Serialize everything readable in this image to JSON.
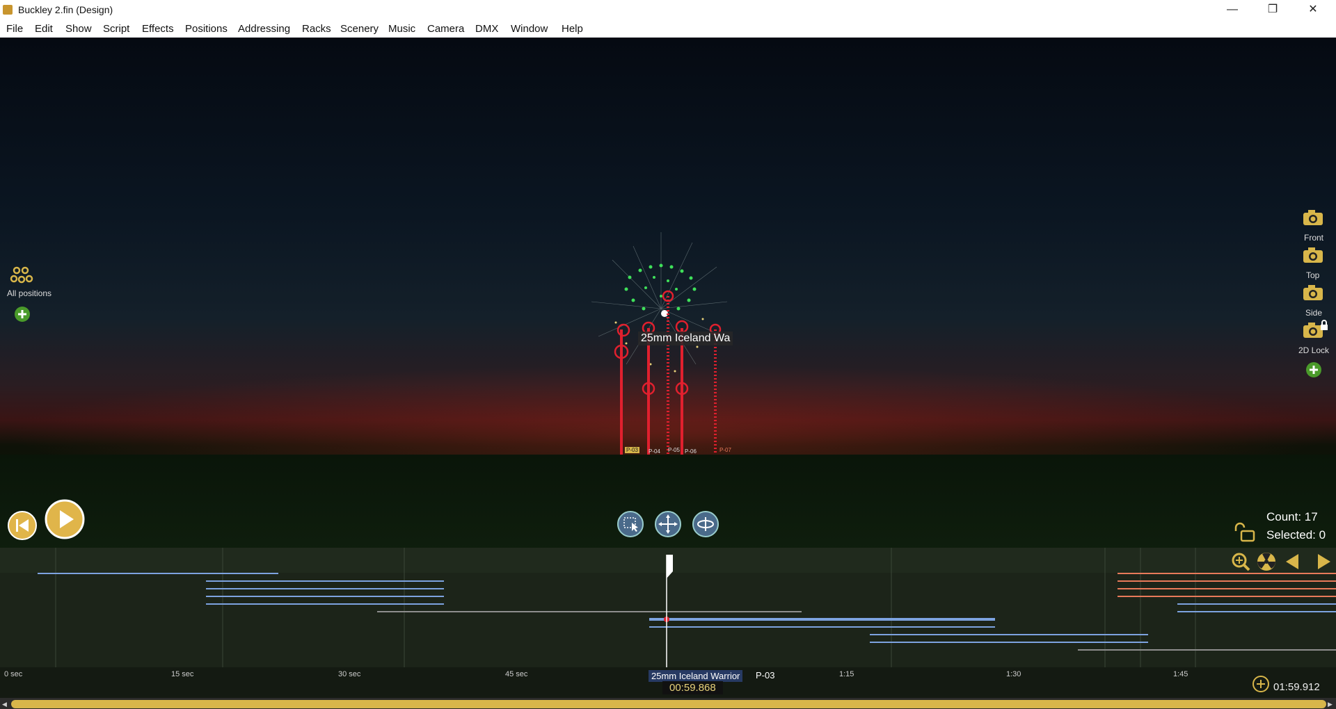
{
  "window": {
    "title": "Buckley 2.fin (Design)",
    "minimize": "—",
    "restore": "❐",
    "close": "✕"
  },
  "menu": [
    "File",
    "Edit",
    "Show",
    "Script",
    "Effects",
    "Positions",
    "Addressing",
    "Racks",
    "Scenery",
    "Music",
    "Camera",
    "DMX",
    "Window",
    "Help"
  ],
  "viewport": {
    "tooltip": "25mm Iceland Wa",
    "all_positions_label": "All positions",
    "cameras": [
      "Front",
      "Top",
      "Side",
      "2D Lock"
    ],
    "position_tags": [
      "P-03",
      "P-04",
      "P-05",
      "P-06",
      "P-07"
    ],
    "count_label": "Count: 17",
    "selected_label": "Selected: 0"
  },
  "timeline": {
    "ticks": [
      "0 sec",
      "15 sec",
      "30 sec",
      "45 sec",
      "1:15",
      "1:30",
      "1:45"
    ],
    "cue_name": "25mm Iceland Warrior",
    "cue_position": "P-03",
    "current_time": "00:59.868",
    "end_time": "01:59.912"
  },
  "colors": {
    "accent": "#d8b64a",
    "trail_red": "#e0202e",
    "burst_green": "#3fe05a",
    "cue_blue": "#7da3e0",
    "cue_red": "#e87a5a"
  }
}
